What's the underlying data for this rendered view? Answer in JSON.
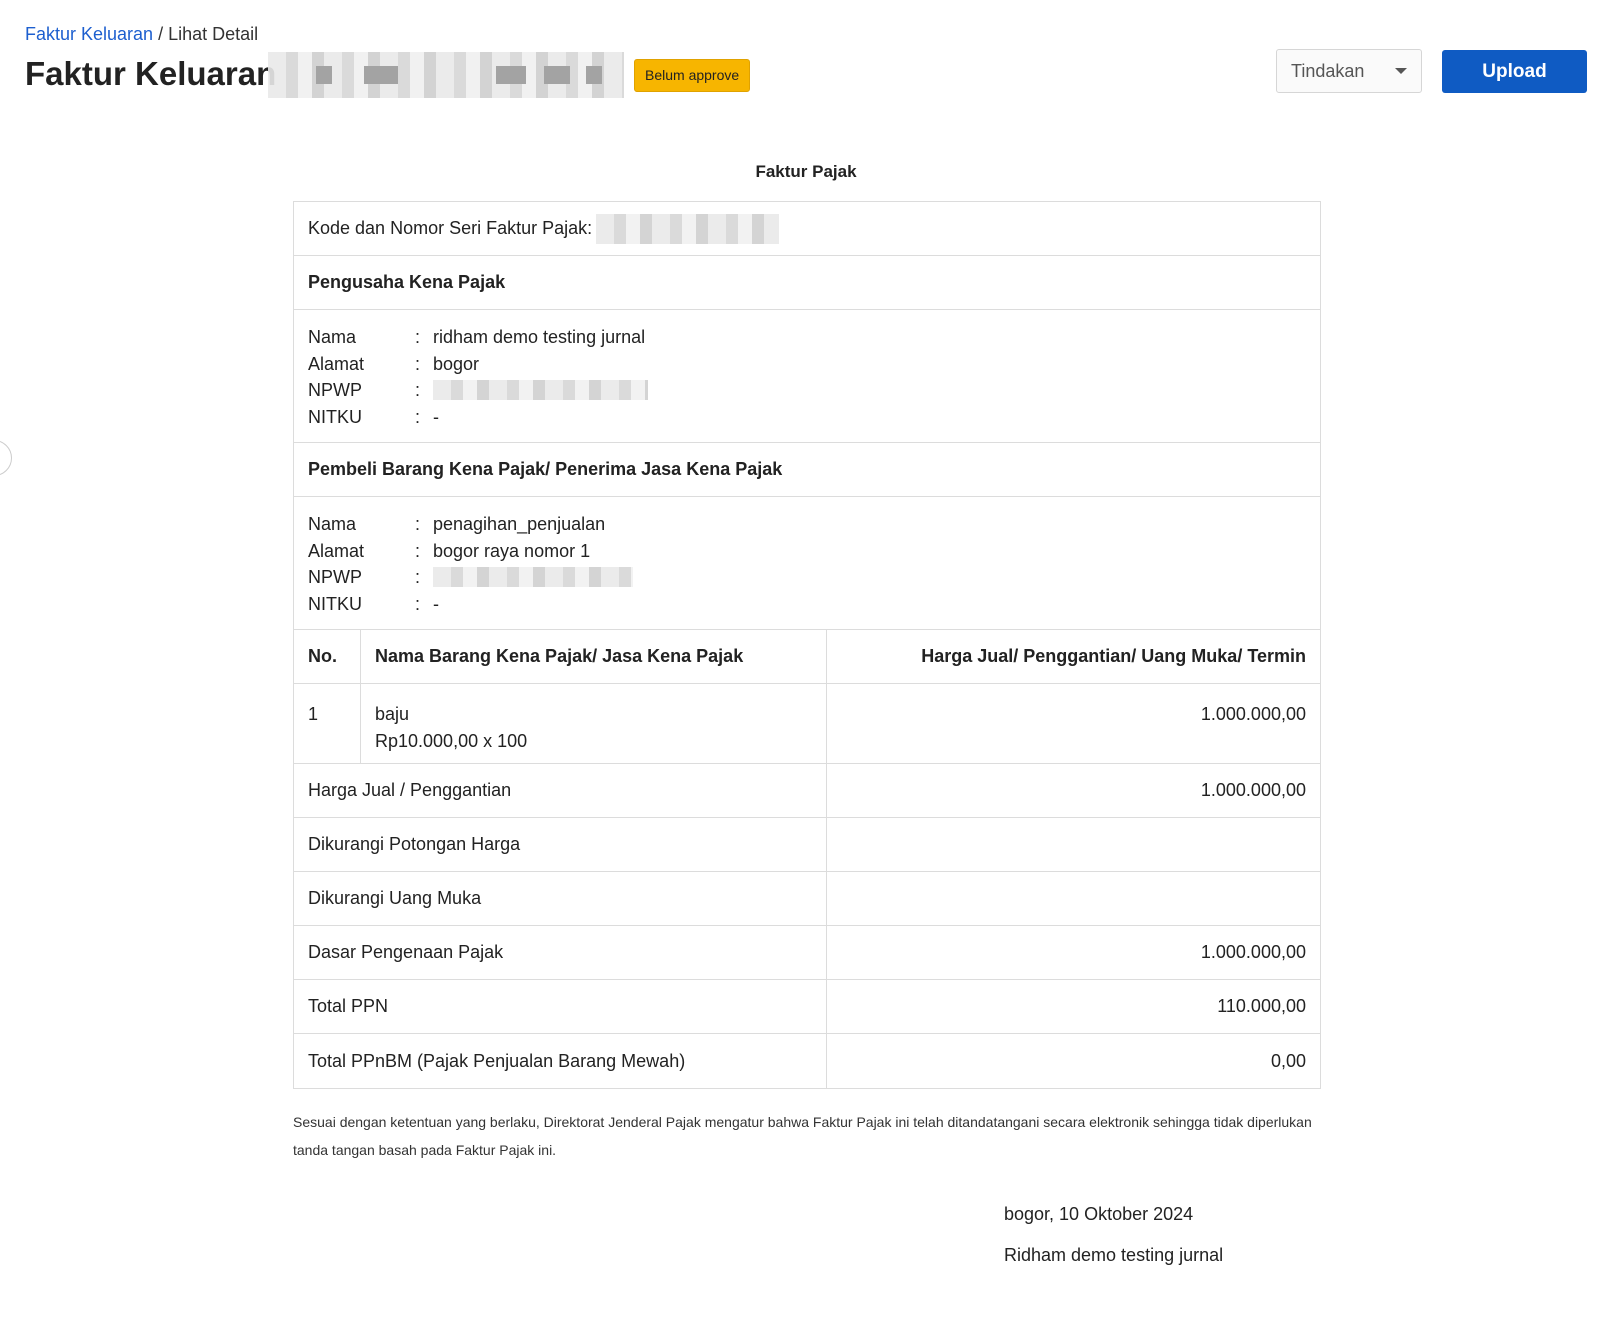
{
  "breadcrumb": {
    "parent": "Faktur Keluaran",
    "separator": "/",
    "current": "Lihat Detail"
  },
  "header": {
    "title": "Faktur Keluaran",
    "status_badge": "Belum approve",
    "actions_dropdown": "Tindakan",
    "upload_button": "Upload"
  },
  "document": {
    "title": "Faktur Pajak",
    "kode_label": "Kode dan Nomor Seri Faktur Pajak:",
    "seller": {
      "heading": "Pengusaha Kena Pajak",
      "fields": [
        {
          "label": "Nama",
          "value": "ridham demo testing jurnal"
        },
        {
          "label": "Alamat",
          "value": "bogor"
        },
        {
          "label": "NPWP",
          "value": ""
        },
        {
          "label": "NITKU",
          "value": "-"
        }
      ]
    },
    "buyer": {
      "heading": "Pembeli Barang Kena Pajak/ Penerima Jasa Kena Pajak",
      "fields": [
        {
          "label": "Nama",
          "value": "penagihan_penjualan"
        },
        {
          "label": "Alamat",
          "value": "bogor raya nomor 1"
        },
        {
          "label": "NPWP",
          "value": ""
        },
        {
          "label": "NITKU",
          "value": "-"
        }
      ]
    },
    "items_table": {
      "columns": [
        "No.",
        "Nama Barang Kena Pajak/ Jasa Kena Pajak",
        "Harga Jual/ Penggantian/ Uang Muka/ Termin"
      ],
      "rows": [
        {
          "no": "1",
          "name": "baju",
          "detail": "Rp10.000,00 x 100",
          "amount": "1.000.000,00"
        }
      ]
    },
    "summary": [
      {
        "label": "Harga Jual / Penggantian",
        "value": "1.000.000,00"
      },
      {
        "label": "Dikurangi Potongan Harga",
        "value": ""
      },
      {
        "label": "Dikurangi Uang Muka",
        "value": ""
      },
      {
        "label": "Dasar Pengenaan Pajak",
        "value": "1.000.000,00"
      },
      {
        "label": "Total PPN",
        "value": "110.000,00"
      },
      {
        "label": "Total PPnBM (Pajak Penjualan Barang Mewah)",
        "value": "0,00"
      }
    ],
    "note": "Sesuai dengan ketentuan yang berlaku, Direktorat Jenderal Pajak mengatur bahwa Faktur Pajak ini telah ditandatangani secara elektronik sehingga tidak diperlukan tanda tangan basah pada Faktur Pajak ini.",
    "place_date": "bogor, 10 Oktober 2024",
    "signer": "Ridham demo testing jurnal"
  },
  "colors": {
    "link": "#1d5fcf",
    "badge": "#f7b500",
    "primary_button": "#0f5bc3"
  },
  "icons": {
    "dropdown": "caret-down-icon"
  }
}
